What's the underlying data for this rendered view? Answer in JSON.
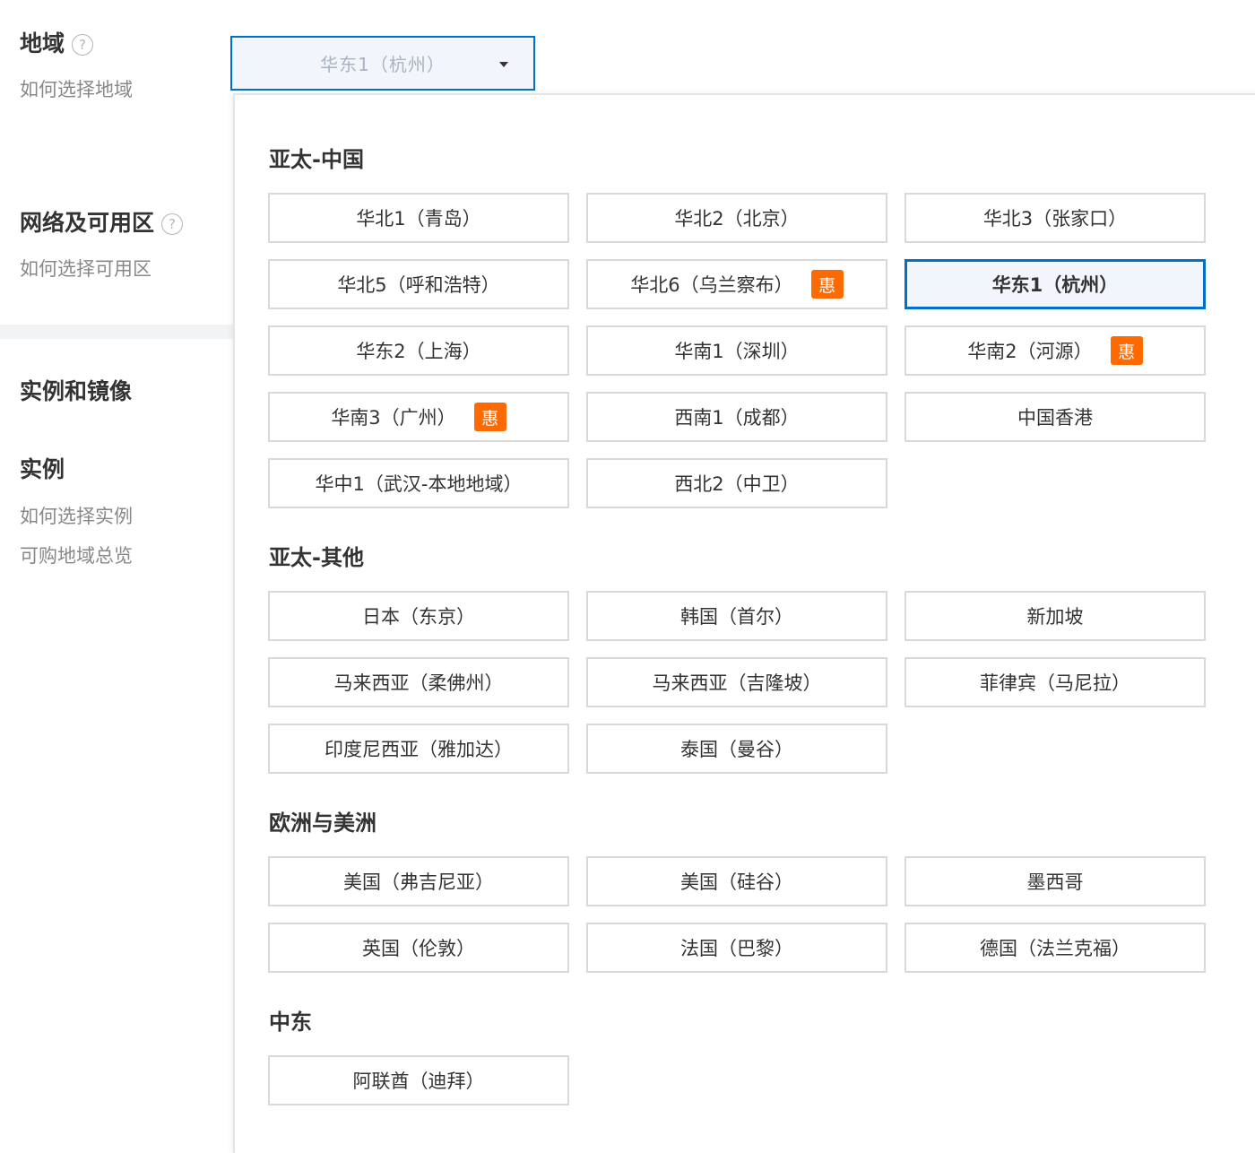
{
  "sidebar": {
    "region_title": "地域",
    "region_help": "如何选择地域",
    "network_title": "网络及可用区",
    "network_help": "如何选择可用区",
    "instance_image_title": "实例和镜像",
    "instance_title": "实例",
    "instance_help": "如何选择实例",
    "instance_regions_link": "可购地域总览",
    "help_icon_glyph": "?"
  },
  "region_select": {
    "value": "华东1（杭州）"
  },
  "groups": {
    "asia_china": {
      "title": "亚太-中国",
      "items": [
        {
          "label": "华北1（青岛）",
          "badge": ""
        },
        {
          "label": "华北2（北京）",
          "badge": ""
        },
        {
          "label": "华北3（张家口）",
          "badge": ""
        },
        {
          "label": "华北5（呼和浩特）",
          "badge": ""
        },
        {
          "label": "华北6（乌兰察布）",
          "badge": "惠"
        },
        {
          "label": "华东1（杭州）",
          "badge": "",
          "selected": true
        },
        {
          "label": "华东2（上海）",
          "badge": ""
        },
        {
          "label": "华南1（深圳）",
          "badge": ""
        },
        {
          "label": "华南2（河源）",
          "badge": "惠"
        },
        {
          "label": "华南3（广州）",
          "badge": "惠"
        },
        {
          "label": "西南1（成都）",
          "badge": ""
        },
        {
          "label": "中国香港",
          "badge": ""
        },
        {
          "label": "华中1（武汉-本地地域）",
          "badge": ""
        },
        {
          "label": "西北2（中卫）",
          "badge": ""
        }
      ]
    },
    "asia_other": {
      "title": "亚太-其他",
      "items": [
        {
          "label": "日本（东京）"
        },
        {
          "label": "韩国（首尔）"
        },
        {
          "label": "新加坡"
        },
        {
          "label": "马来西亚（柔佛州）"
        },
        {
          "label": "马来西亚（吉隆坡）"
        },
        {
          "label": "菲律宾（马尼拉）"
        },
        {
          "label": "印度尼西亚（雅加达）"
        },
        {
          "label": "泰国（曼谷）"
        }
      ]
    },
    "europe_america": {
      "title": "欧洲与美洲",
      "items": [
        {
          "label": "美国（弗吉尼亚）"
        },
        {
          "label": "美国（硅谷）"
        },
        {
          "label": "墨西哥"
        },
        {
          "label": "英国（伦敦）"
        },
        {
          "label": "法国（巴黎）"
        },
        {
          "label": "德国（法兰克福）"
        }
      ]
    },
    "middle_east": {
      "title": "中东",
      "items": [
        {
          "label": "阿联酋（迪拜）"
        }
      ]
    }
  },
  "colors": {
    "accent": "#0070cc",
    "badge": "#ff6a00",
    "selected_bg": "#f2f6fc"
  }
}
